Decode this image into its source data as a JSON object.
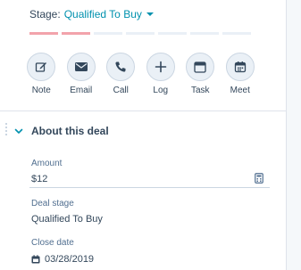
{
  "stage": {
    "label": "Stage:",
    "value": "Qualified To Buy",
    "segments": [
      true,
      true,
      false,
      false,
      false,
      false,
      false
    ]
  },
  "actions": [
    {
      "id": "note",
      "label": "Note",
      "icon": "pencil-icon"
    },
    {
      "id": "email",
      "label": "Email",
      "icon": "envelope-icon"
    },
    {
      "id": "call",
      "label": "Call",
      "icon": "phone-icon"
    },
    {
      "id": "log",
      "label": "Log",
      "icon": "plus-icon"
    },
    {
      "id": "task",
      "label": "Task",
      "icon": "task-window-icon"
    },
    {
      "id": "meet",
      "label": "Meet",
      "icon": "calendar-icon"
    }
  ],
  "section": {
    "title": "About this deal"
  },
  "fields": {
    "amount": {
      "label": "Amount",
      "value": "$12"
    },
    "deal_stage": {
      "label": "Deal stage",
      "value": "Qualified To Buy"
    },
    "close_date": {
      "label": "Close date",
      "value": "03/28/2019"
    }
  },
  "colors": {
    "accent": "#0091ae",
    "progress_filled": "#f2a3ab",
    "progress_empty": "#eaf0f6",
    "text": "#33475b"
  }
}
